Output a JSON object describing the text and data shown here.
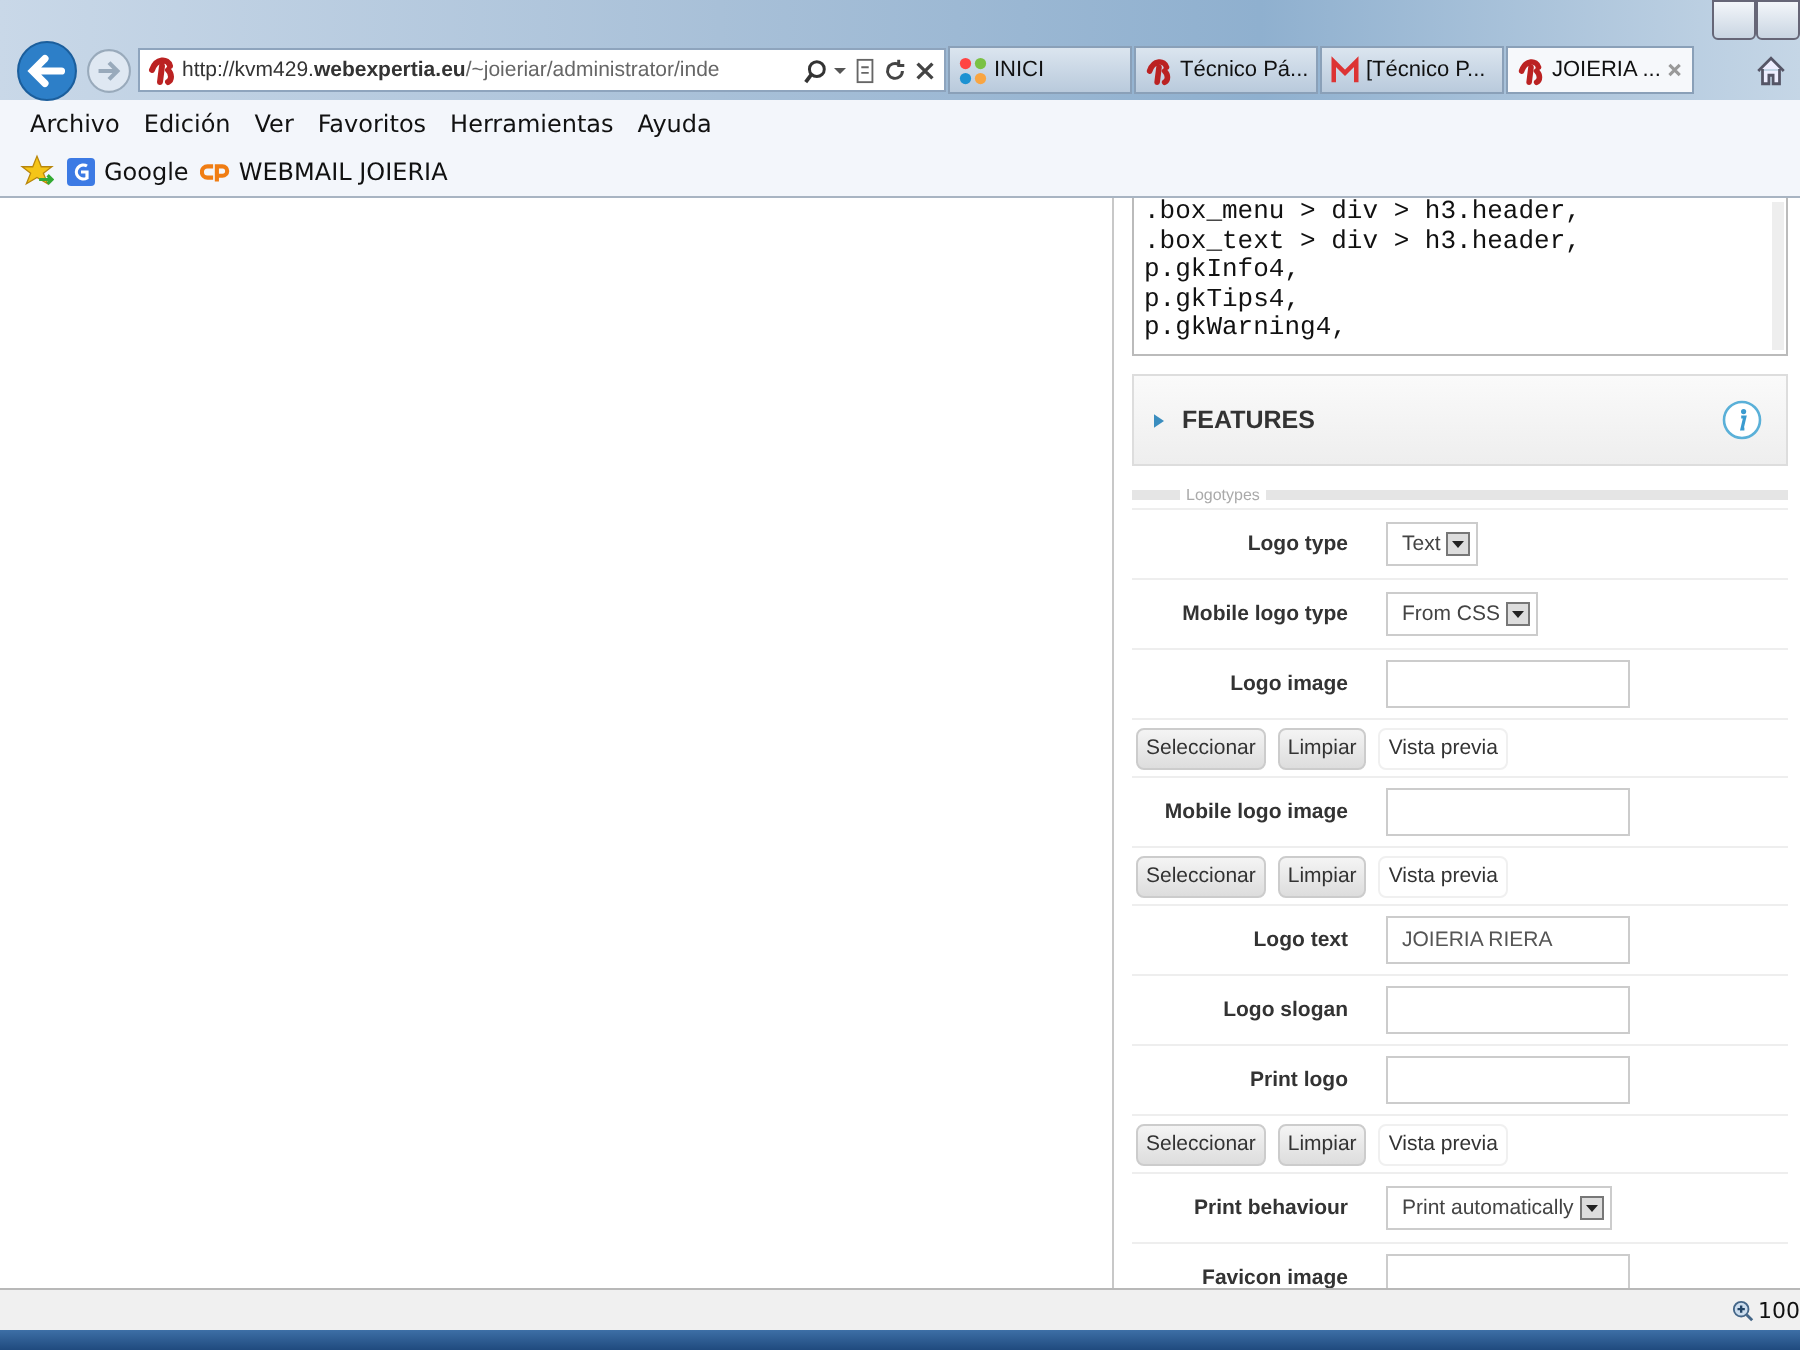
{
  "browser": {
    "address": {
      "prefix": "http://kvm429.",
      "domain": "webexpertia.eu",
      "path": "/~joieriar/administrator/inde"
    },
    "tabs": [
      {
        "label": "INICI",
        "selected": false
      },
      {
        "label": "Técnico Pá...",
        "selected": false
      },
      {
        "label": "[Técnico P...",
        "selected": false
      },
      {
        "label": "JOIERIA ...",
        "selected": true
      }
    ],
    "menu": [
      "Archivo",
      "Edición",
      "Ver",
      "Favoritos",
      "Herramientas",
      "Ayuda"
    ],
    "favorites": [
      "Google",
      "WEBMAIL JOIERIA"
    ],
    "status_bar": {
      "zoom": "100"
    }
  },
  "panel": {
    "css_lines": [
      ".box_menu > div > h3.header,",
      ".box_text > div > h3.header,",
      "p.gkInfo4,",
      "p.gkTips4,",
      "p.gkWarning4,"
    ],
    "section": {
      "title": "FEATURES",
      "expanded": false
    },
    "legend": "Logotypes",
    "rows": [
      {
        "kind": "select",
        "label": "Logo type",
        "value": "Text"
      },
      {
        "kind": "select",
        "label": "Mobile logo type",
        "value": "From CSS"
      },
      {
        "kind": "input",
        "label": "Logo image",
        "value": ""
      },
      {
        "kind": "buttons",
        "buttons": [
          "Seleccionar",
          "Limpiar",
          "Vista previa"
        ]
      },
      {
        "kind": "input",
        "label": "Mobile logo image",
        "value": ""
      },
      {
        "kind": "buttons",
        "buttons": [
          "Seleccionar",
          "Limpiar",
          "Vista previa"
        ]
      },
      {
        "kind": "input",
        "label": "Logo text",
        "value": "JOIERIA RIERA"
      },
      {
        "kind": "input",
        "label": "Logo slogan",
        "value": ""
      },
      {
        "kind": "input",
        "label": "Print logo",
        "value": ""
      },
      {
        "kind": "buttons",
        "buttons": [
          "Seleccionar",
          "Limpiar",
          "Vista previa"
        ]
      },
      {
        "kind": "select",
        "label": "Print behaviour",
        "value": "Print automatically"
      },
      {
        "kind": "input",
        "label": "Favicon image",
        "value": ""
      }
    ]
  }
}
